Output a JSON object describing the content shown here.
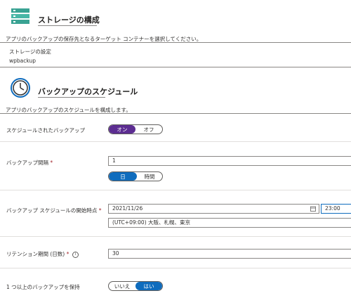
{
  "storage": {
    "title": "ストレージの構成",
    "description": "アプリのバックアップの保存先となるターゲット コンテナーを選択してください。",
    "settings_label": "ストレージの設定",
    "settings_value": "wpbackup"
  },
  "schedule": {
    "title": "バックアップのスケジュール",
    "description": "アプリのバックアップのスケジュールを構成します。",
    "scheduled_backup": {
      "label": "スケジュールされたバックアップ",
      "on": "オン",
      "off": "オフ",
      "selected": "オン"
    },
    "interval": {
      "label": "バックアップ間隔",
      "required_mark": "*",
      "value": "1",
      "unit_day": "日",
      "unit_hour": "時間",
      "selected_unit": "日"
    },
    "start_time": {
      "label": "バックアップ スケジュールの開始時点",
      "required_mark": "*",
      "date": "2021/11/26",
      "time": "23:00",
      "timezone": "(UTC+09:00) 大阪、札幌、東京"
    },
    "retention": {
      "label": "リテンション期間 (日数)",
      "required_mark": "*",
      "value": "30"
    },
    "keep_one": {
      "label": "1 つ以上のバックアップを保持",
      "no": "いいえ",
      "yes": "はい",
      "selected": "はい"
    }
  },
  "colors": {
    "toggle_on": "#5c2d91",
    "toggle_blue": "#0f6cbd",
    "storage_icon": "#3aa393"
  }
}
